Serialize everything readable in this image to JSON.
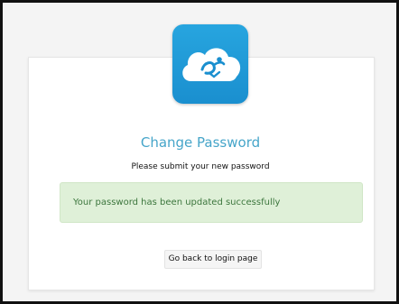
{
  "app": {
    "logo_icon": "cloud-person-logo-icon",
    "brand_color": "#1a93d3"
  },
  "page": {
    "title": "Change Password",
    "subtitle": "Please submit your new password"
  },
  "alert": {
    "message": "Your password has been updated successfully",
    "type": "success",
    "background_color": "#dff0d8",
    "text_color": "#3c763d"
  },
  "actions": {
    "back_to_login_label": "Go back to login page"
  }
}
